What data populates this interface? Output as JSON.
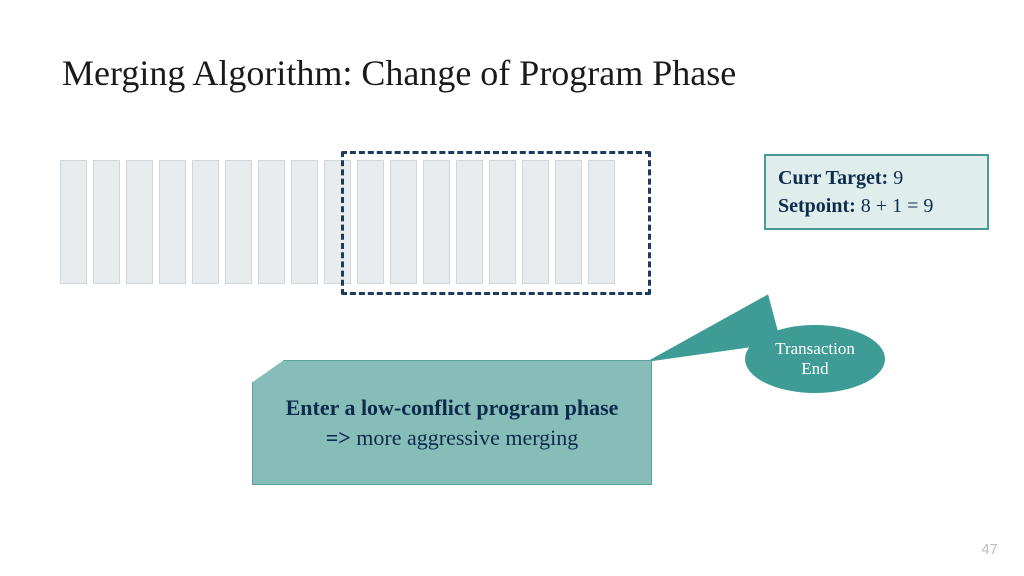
{
  "title": "Merging Algorithm: Change of Program Phase",
  "bars": {
    "total_count": 17,
    "grouped_count": 9
  },
  "info": {
    "curr_target_label": "Curr Target:",
    "curr_target_value": "9",
    "setpoint_label": "Setpoint:",
    "setpoint_value": "8 + 1 = 9"
  },
  "callout": {
    "line1": "Transaction",
    "line2": "End"
  },
  "phase": {
    "line1": "Enter a low-conflict program phase",
    "arrow": "=>",
    "line2_text": " more aggressive merging"
  },
  "page_number": "47",
  "colors": {
    "bar_fill": "#e8ecef",
    "dashed_border": "#1f3a5f",
    "teal_fill": "#87bdb8",
    "teal_dark": "#3e9b96",
    "info_fill": "#dfeeec",
    "dark_text": "#0d2b4c"
  }
}
